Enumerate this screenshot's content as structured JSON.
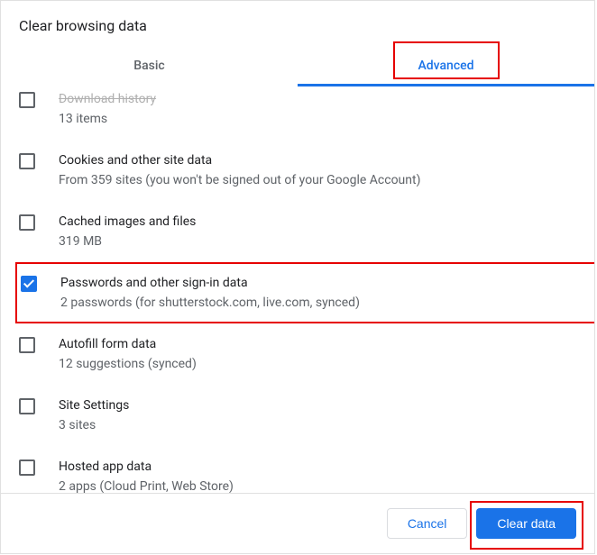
{
  "dialog": {
    "title": "Clear browsing data"
  },
  "tabs": {
    "basic": "Basic",
    "advanced": "Advanced"
  },
  "items": [
    {
      "title": "Download history",
      "sub": "13 items",
      "checked": false,
      "cutoff": true
    },
    {
      "title": "Cookies and other site data",
      "sub": "From 359 sites (you won't be signed out of your Google Account)",
      "checked": false
    },
    {
      "title": "Cached images and files",
      "sub": "319 MB",
      "checked": false
    },
    {
      "title": "Passwords and other sign-in data",
      "sub": "2 passwords (for shutterstock.com, live.com, synced)",
      "checked": true,
      "highlight": true
    },
    {
      "title": "Autofill form data",
      "sub": "12 suggestions (synced)",
      "checked": false
    },
    {
      "title": "Site Settings",
      "sub": "3 sites",
      "checked": false
    },
    {
      "title": "Hosted app data",
      "sub": "2 apps (Cloud Print, Web Store)",
      "checked": false
    }
  ],
  "footer": {
    "cancel": "Cancel",
    "clear": "Clear data"
  }
}
